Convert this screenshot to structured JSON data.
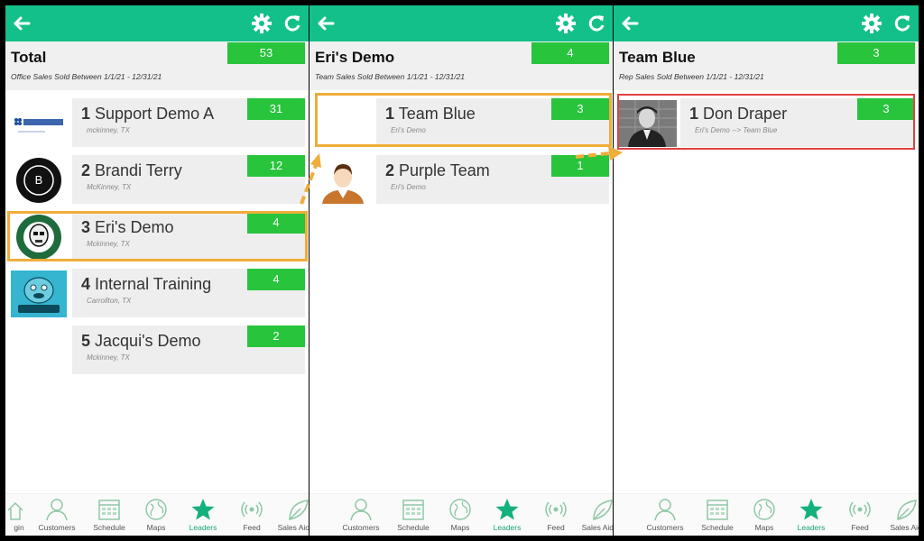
{
  "colors": {
    "accent": "#14c08a",
    "badge": "#27c43c",
    "highlight": "#f0ad3a",
    "select": "#e04040"
  },
  "panels": [
    {
      "title": "Total",
      "subtitle": "Office Sales Sold Between 1/1/21 - 12/31/21",
      "count": "53",
      "rows": [
        {
          "rank": "1",
          "name": "Support Demo A",
          "location": "mckinney, TX",
          "value": "31",
          "avatar": "pestroutes-logo"
        },
        {
          "rank": "2",
          "name": "Brandi Terry",
          "location": "McKinney, TX",
          "value": "12",
          "avatar": "initial-b-avatar",
          "initial": "B"
        },
        {
          "rank": "3",
          "name": "Eri's Demo",
          "location": "Mckinney, TX",
          "value": "4",
          "avatar": "star-wars-coffee-logo"
        },
        {
          "rank": "4",
          "name": "Internal Training",
          "location": "Carrollton, TX",
          "value": "4",
          "avatar": "meeseeks-logo"
        },
        {
          "rank": "5",
          "name": "Jacqui's Demo",
          "location": "Mckinney, TX",
          "value": "2",
          "avatar": "none"
        }
      ]
    },
    {
      "title": "Eri's Demo",
      "subtitle": "Team Sales Sold Between 1/1/21 - 12/31/21",
      "count": "4",
      "rows": [
        {
          "rank": "1",
          "name": "Team Blue",
          "location": "Eri's Demo",
          "value": "3",
          "avatar": "none"
        },
        {
          "rank": "2",
          "name": "Purple Team",
          "location": "Eri's Demo",
          "value": "1",
          "avatar": "person-avatar"
        }
      ]
    },
    {
      "title": "Team Blue",
      "subtitle": "Rep Sales Sold Between 1/1/21 - 12/31/21",
      "count": "3",
      "rows": [
        {
          "rank": "1",
          "name": "Don Draper",
          "location": "Eri's Demo --> Team Blue",
          "value": "3",
          "avatar": "photo-avatar"
        }
      ]
    }
  ],
  "tabbars": [
    [
      "gin",
      "Customers",
      "Schedule",
      "Maps",
      "Leaders",
      "Feed",
      "Sales Aiogin"
    ],
    [
      "Customers",
      "Schedule",
      "Maps",
      "Leaders",
      "Feed",
      "Sales Aidgin"
    ],
    [
      "Customers",
      "Schedule",
      "Maps",
      "Leaders",
      "Feed",
      "Sales Aidi"
    ]
  ],
  "active_tab": "Leaders"
}
